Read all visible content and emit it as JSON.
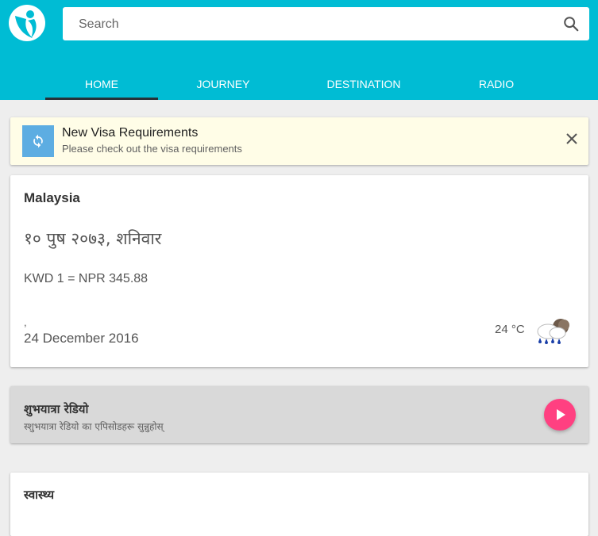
{
  "search": {
    "placeholder": "Search"
  },
  "tabs": [
    {
      "label": "HOME"
    },
    {
      "label": "JOURNEY"
    },
    {
      "label": "DESTINATION"
    },
    {
      "label": "RADIO"
    }
  ],
  "notice": {
    "title": "New Visa Requirements",
    "subtitle": "Please check out the visa requirements"
  },
  "info_card": {
    "country": "Malaysia",
    "nepali_date": "१० पुष २०७३, शनिवार",
    "exchange_rate": "KWD 1 = NPR 345.88",
    "separator": ",",
    "date": "24 December 2016",
    "temperature": "24 °C",
    "weather_icon": "rain-cloud-icon"
  },
  "radio_card": {
    "title": "शुभयात्रा रेडियो",
    "subtitle": "स्शुभयात्रा रेडियो का एपिसोडहरू सुन्नुहोस्"
  },
  "health_card": {
    "title": "स्वास्थ्य"
  },
  "colors": {
    "header": "#00bcd4",
    "accent": "#ff4081",
    "notice_bg": "#fffde7",
    "sync_icon_bg": "#5dade2"
  }
}
